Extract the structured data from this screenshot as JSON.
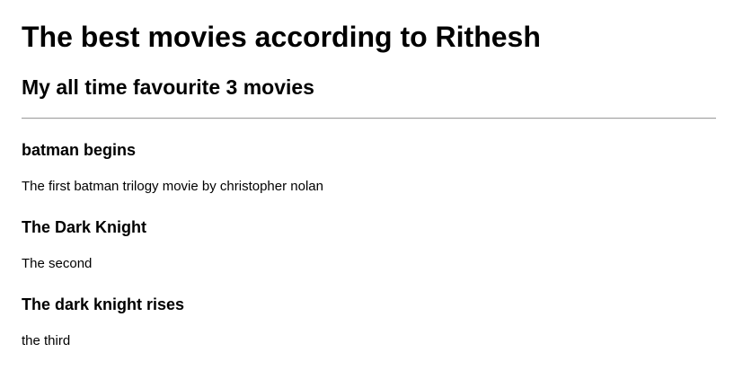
{
  "page": {
    "heading": "The best movies according to Rithesh",
    "subheading": "My all time favourite 3 movies"
  },
  "movies": [
    {
      "title": "batman begins",
      "description": "The first batman trilogy movie by christopher nolan"
    },
    {
      "title": "The Dark Knight",
      "description": "The second"
    },
    {
      "title": "The dark knight rises",
      "description": "the third"
    }
  ]
}
